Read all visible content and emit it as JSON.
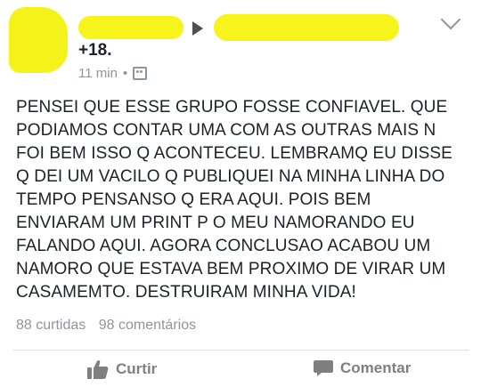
{
  "post": {
    "group_name": "+18.",
    "time": "11 min",
    "privacy_separator": "•",
    "privacy_icon": "group-icon",
    "text_lines": [
      "PENSEI QUE ESSE GRUPO FOSSE CONFIAVEL. QUE",
      "PODIAMOS CONTAR UMA COM AS OUTRAS MAIS N",
      "FOI BEM ISSO Q ACONTECEU. LEMBRAMQ EU DISSE",
      "Q DEI UM VACILO Q PUBLIQUEI NA MINHA LINHA DO",
      "TEMPO PENSANSO Q ERA AQUI.  POIS BEM",
      "ENVIARAM UM PRINT P O MEU NAMORANDO EU",
      "FALANDO AQUI. AGORA CONCLUSAO ACABOU UM",
      "NAMORO QUE ESTAVA BEM PROXIMO DE VIRAR UM",
      "CASAMEMTO. DESTRUIRAM MINHA VIDA!"
    ],
    "likes": "88 curtidas",
    "comments": "98 comentários"
  },
  "actions": {
    "like_label": "Curtir",
    "comment_label": "Comentar"
  },
  "colors": {
    "censor_yellow": "#f6f41a",
    "meta_gray": "#90949c",
    "text": "#1d2129"
  }
}
